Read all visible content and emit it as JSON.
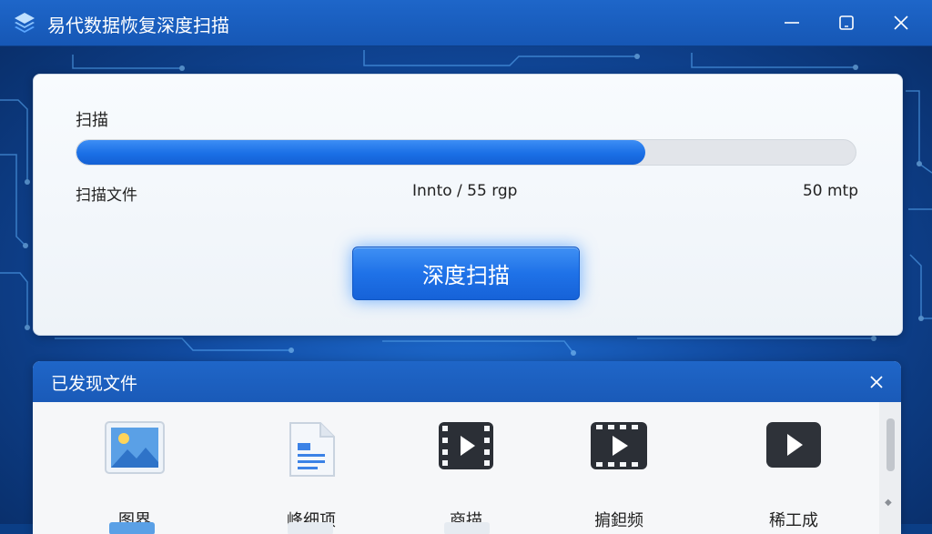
{
  "window": {
    "title": "易代数据恢复深度扫描",
    "app_icon": "layers-icon",
    "controls": [
      "minimize-icon",
      "maximize-icon",
      "close-icon"
    ]
  },
  "scan": {
    "label": "扫描",
    "progress_fraction": 0.73,
    "files_label": "扫描文件",
    "counter": "Innto / 55 rgp",
    "size": "50 mtp",
    "button_label": "深度扫描"
  },
  "found": {
    "title": "已发现文件",
    "items": [
      {
        "label": "图界",
        "icon": "image-file-icon"
      },
      {
        "label": "峰细项",
        "icon": "document-file-icon"
      },
      {
        "label": "商描",
        "icon": "video-file-icon"
      },
      {
        "label": "掮鉭频",
        "icon": "video-file-icon"
      },
      {
        "label": "稀工成",
        "icon": "play-file-icon"
      }
    ]
  },
  "colors": {
    "accent": "#1a6fe6",
    "titlebar": "#1a5db9",
    "background": "#0b3e86"
  }
}
